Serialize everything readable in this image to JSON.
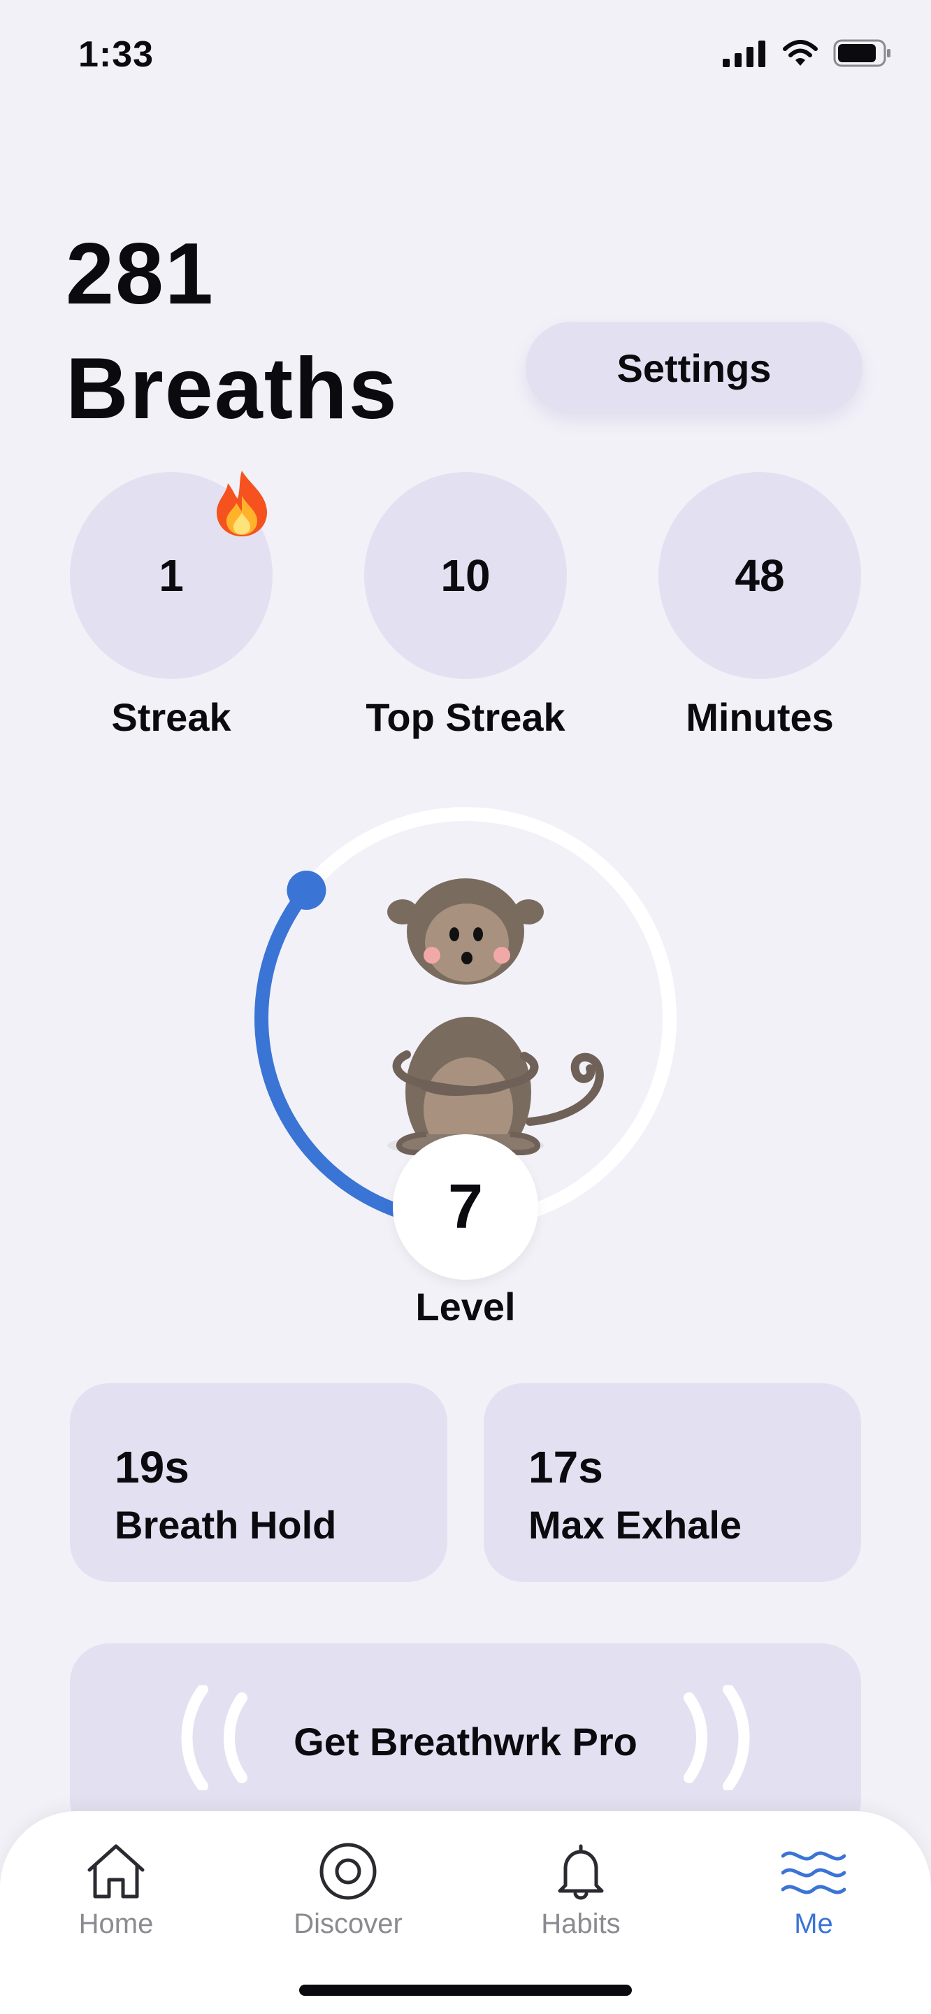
{
  "status_bar": {
    "time": "1:33"
  },
  "header": {
    "breath_count": "281",
    "breath_label": "Breaths",
    "settings_label": "Settings"
  },
  "stats": [
    {
      "value": "1",
      "label": "Streak"
    },
    {
      "value": "10",
      "label": "Top Streak"
    },
    {
      "value": "48",
      "label": "Minutes"
    }
  ],
  "level": {
    "value": "7",
    "label": "Level",
    "progress_fraction": 0.33
  },
  "records": [
    {
      "value": "19s",
      "label": "Breath Hold"
    },
    {
      "value": "17s",
      "label": "Max Exhale"
    }
  ],
  "pro_button": {
    "label": "Get Breathwrk Pro"
  },
  "tabs": [
    {
      "label": "Home",
      "icon": "home-icon",
      "active": false
    },
    {
      "label": "Discover",
      "icon": "discover-icon",
      "active": false
    },
    {
      "label": "Habits",
      "icon": "bell-icon",
      "active": false
    },
    {
      "label": "Me",
      "icon": "waves-icon",
      "active": true
    }
  ],
  "colors": {
    "accent": "#3a74d5",
    "card": "#e3e1f1",
    "background": "#f2f1f8"
  }
}
